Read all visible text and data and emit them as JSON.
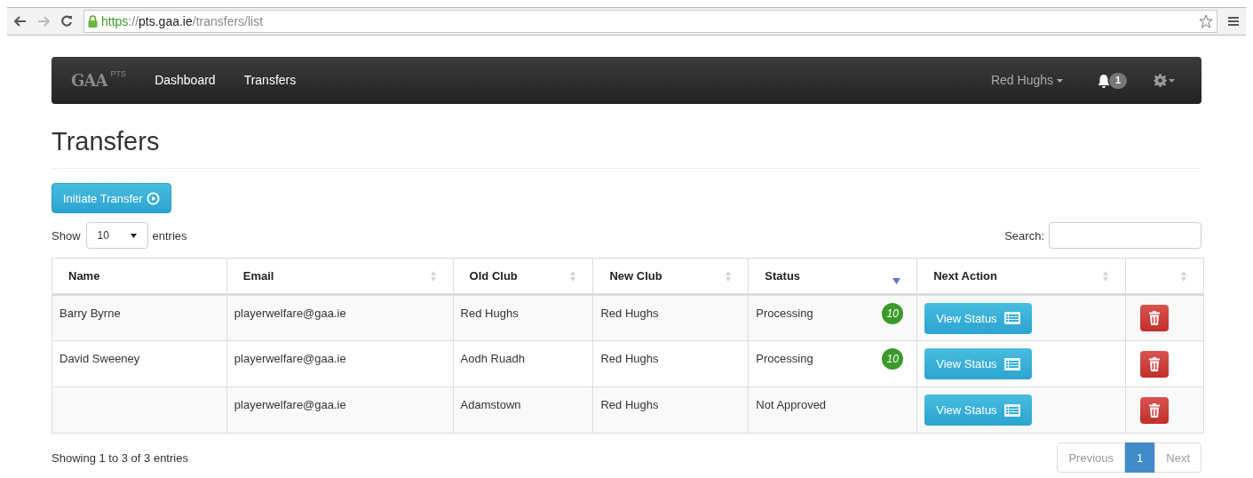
{
  "browser": {
    "url": {
      "scheme": "https",
      "sep": "://",
      "host": "pts.gaa.ie",
      "path": "/transfers/list"
    }
  },
  "navbar": {
    "logo": "GAA",
    "logo_sup": "PTS",
    "links": [
      {
        "label": "Dashboard"
      },
      {
        "label": "Transfers"
      }
    ],
    "user": "Red Hughs",
    "notifications": "1"
  },
  "page": {
    "title": "Transfers",
    "initiate_button": "Initiate Transfer"
  },
  "table_controls": {
    "show_label": "Show",
    "page_size": "10",
    "entries_label": "entries",
    "search_label": "Search:"
  },
  "table": {
    "columns": [
      {
        "label": "Name",
        "sortable": false,
        "sorted": false
      },
      {
        "label": "Email",
        "sortable": true,
        "sorted": false
      },
      {
        "label": "Old Club",
        "sortable": true,
        "sorted": false
      },
      {
        "label": "New Club",
        "sortable": true,
        "sorted": false
      },
      {
        "label": "Status",
        "sortable": true,
        "sorted": true
      },
      {
        "label": "Next Action",
        "sortable": true,
        "sorted": false
      },
      {
        "sortable": true,
        "sorted": false
      }
    ],
    "rows": [
      {
        "name": "Barry Byrne",
        "email": "playerwelfare@gaa.ie",
        "old_club": "Red Hughs",
        "new_club": "Red Hughs",
        "status": "Processing",
        "badge": "10",
        "action": "View Status"
      },
      {
        "name": "David Sweeney",
        "email": "playerwelfare@gaa.ie",
        "old_club": "Aodh Ruadh",
        "new_club": "Red Hughs",
        "status": "Processing",
        "badge": "10",
        "action": "View Status"
      },
      {
        "email": "playerwelfare@gaa.ie",
        "old_club": "Adamstown",
        "new_club": "Red Hughs",
        "status": "Not Approved",
        "action": "View Status"
      }
    ]
  },
  "footer": {
    "info": "Showing 1 to 3 of 3 entries",
    "pagination": [
      {
        "label": "Previous",
        "selected": false
      },
      {
        "label": "1",
        "selected": true
      },
      {
        "label": "Next",
        "selected": false
      }
    ]
  }
}
